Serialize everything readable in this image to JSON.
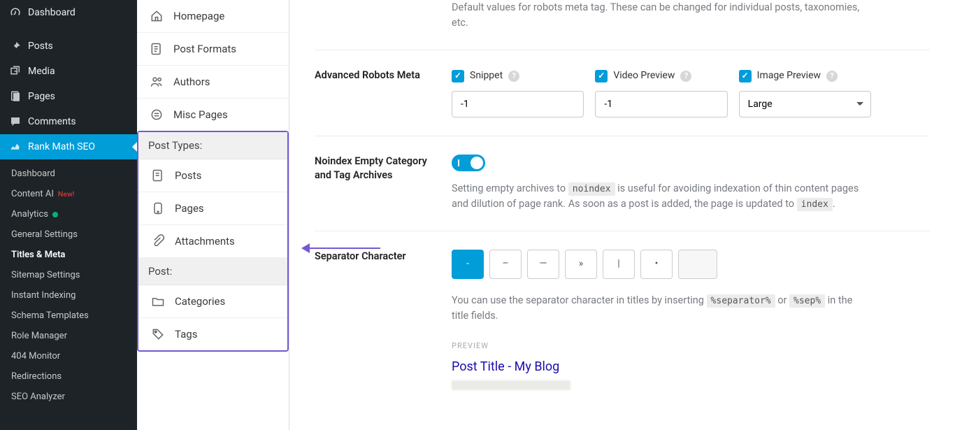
{
  "wp_menu": {
    "top": [
      {
        "label": "Dashboard",
        "icon": "gauge"
      },
      {
        "label": "Posts",
        "icon": "pin"
      },
      {
        "label": "Media",
        "icon": "media"
      },
      {
        "label": "Pages",
        "icon": "page"
      },
      {
        "label": "Comments",
        "icon": "comment"
      },
      {
        "label": "Rank Math SEO",
        "icon": "seo",
        "active": true
      }
    ],
    "sub": [
      {
        "label": "Dashboard"
      },
      {
        "label": "Content AI",
        "badge": "New!"
      },
      {
        "label": "Analytics",
        "dot": true
      },
      {
        "label": "General Settings"
      },
      {
        "label": "Titles & Meta",
        "current": true
      },
      {
        "label": "Sitemap Settings"
      },
      {
        "label": "Instant Indexing"
      },
      {
        "label": "Schema Templates"
      },
      {
        "label": "Role Manager"
      },
      {
        "label": "404 Monitor"
      },
      {
        "label": "Redirections"
      },
      {
        "label": "SEO Analyzer"
      }
    ]
  },
  "subpanel": {
    "group1": [
      {
        "label": "Homepage",
        "icon": "home"
      },
      {
        "label": "Post Formats",
        "icon": "formats"
      },
      {
        "label": "Authors",
        "icon": "users"
      },
      {
        "label": "Misc Pages",
        "icon": "misc"
      }
    ],
    "post_types_header": "Post Types:",
    "post_types": [
      {
        "label": "Posts",
        "icon": "post"
      },
      {
        "label": "Pages",
        "icon": "phone"
      },
      {
        "label": "Attachments",
        "icon": "clip"
      }
    ],
    "post_header": "Post:",
    "post_tax": [
      {
        "label": "Categories",
        "icon": "folder"
      },
      {
        "label": "Tags",
        "icon": "tag"
      }
    ]
  },
  "content": {
    "intro": "Default values for robots meta tag. These can be changed for individual posts, taxonomies, etc.",
    "robots": {
      "label": "Advanced Robots Meta",
      "snippet": {
        "label": "Snippet",
        "value": "-1"
      },
      "video": {
        "label": "Video Preview",
        "value": "-1"
      },
      "image": {
        "label": "Image Preview",
        "value": "Large"
      }
    },
    "noindex": {
      "label": "Noindex Empty Category and Tag Archives",
      "pre": "Setting empty archives to ",
      "code1": "noindex",
      "mid": " is useful for avoiding indexation of thin content pages and dilution of page rank. As soon as a post is added, the page is updated to ",
      "code2": "index",
      "post": "."
    },
    "separator": {
      "label": "Separator Character",
      "opts": [
        "-",
        "–",
        "—",
        "»",
        "|",
        "•"
      ],
      "desc_pre": "You can use the separator character in titles by inserting ",
      "code1": "%separator%",
      "mid": " or ",
      "code2": "%sep%",
      "post": " in the title fields.",
      "preview_label": "PREVIEW",
      "preview_title": "Post Title - My Blog"
    }
  }
}
